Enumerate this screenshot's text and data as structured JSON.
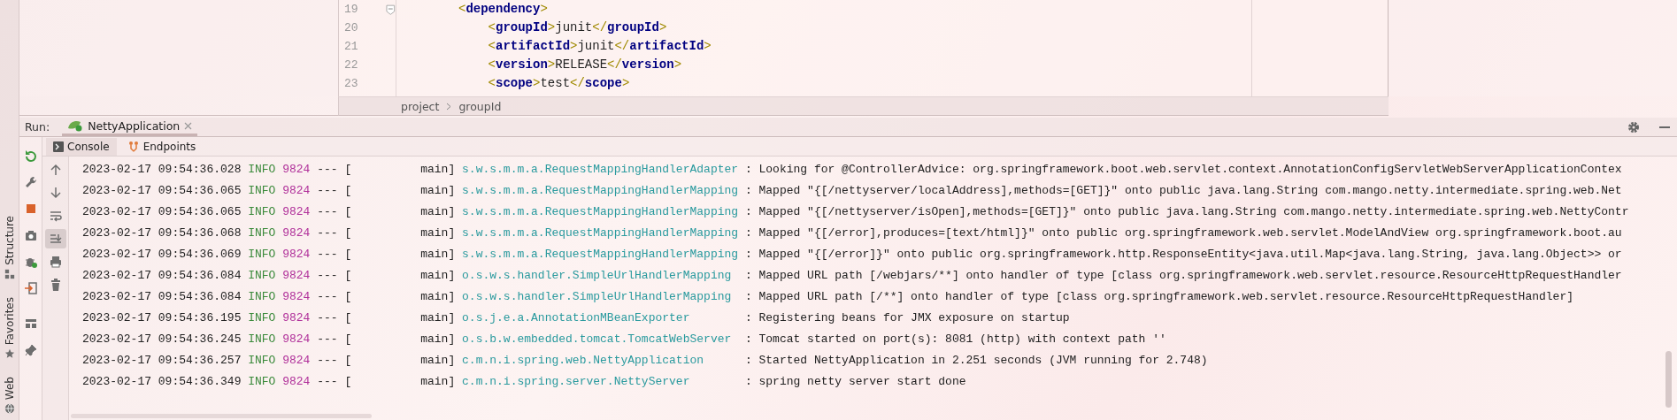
{
  "tool_stripe": {
    "labels": [
      {
        "kind": "structure",
        "text": "Structure"
      },
      {
        "kind": "favorites",
        "text": "Favorites"
      },
      {
        "kind": "web",
        "text": "Web"
      }
    ]
  },
  "editor": {
    "lines": [
      {
        "number": "19",
        "code": "<dependency>",
        "foldable": true
      },
      {
        "number": "20",
        "code": "    <groupId>junit</groupId>",
        "foldable": false
      },
      {
        "number": "21",
        "code": "    <artifactId>junit</artifactId>",
        "foldable": false
      },
      {
        "number": "22",
        "code": "    <version>RELEASE</version>",
        "foldable": false
      },
      {
        "number": "23",
        "code": "    <scope>test</scope>",
        "foldable": false
      }
    ]
  },
  "breadcrumbs": [
    "project",
    "groupId"
  ],
  "run_panel": {
    "label": "Run:",
    "tabs": [
      {
        "label": "NettyApplication",
        "selected": true
      }
    ],
    "subtabs": [
      {
        "kind": "console",
        "label": "Console",
        "selected": true
      },
      {
        "kind": "endpoints",
        "label": "Endpoints",
        "selected": false
      }
    ],
    "console_actions": [
      {
        "kind": "up",
        "on": false
      },
      {
        "kind": "down",
        "on": false
      },
      {
        "kind": "wrap",
        "on": false
      },
      {
        "kind": "scroll-end",
        "on": true
      },
      {
        "kind": "print",
        "on": false
      },
      {
        "kind": "trash",
        "on": false
      }
    ],
    "log": [
      {
        "time": "2023-02-17 09:54:36.028",
        "level": "INFO",
        "pid": "9824",
        "sep": "--- [",
        "thread": "main]",
        "logger": "s.w.s.m.m.a.RequestMappingHandlerAdapter",
        "message": ": Looking for @ControllerAdvice: org.springframework.boot.web.servlet.context.AnnotationConfigServletWebServerApplicationContex"
      },
      {
        "time": "2023-02-17 09:54:36.065",
        "level": "INFO",
        "pid": "9824",
        "sep": "--- [",
        "thread": "main]",
        "logger": "s.w.s.m.m.a.RequestMappingHandlerMapping",
        "message": ": Mapped \"{[/nettyserver/localAddress],methods=[GET]}\" onto public java.lang.String com.mango.netty.intermediate.spring.web.Net"
      },
      {
        "time": "2023-02-17 09:54:36.065",
        "level": "INFO",
        "pid": "9824",
        "sep": "--- [",
        "thread": "main]",
        "logger": "s.w.s.m.m.a.RequestMappingHandlerMapping",
        "message": ": Mapped \"{[/nettyserver/isOpen],methods=[GET]}\" onto public java.lang.String com.mango.netty.intermediate.spring.web.NettyContr"
      },
      {
        "time": "2023-02-17 09:54:36.068",
        "level": "INFO",
        "pid": "9824",
        "sep": "--- [",
        "thread": "main]",
        "logger": "s.w.s.m.m.a.RequestMappingHandlerMapping",
        "message": ": Mapped \"{[/error],produces=[text/html]}\" onto public org.springframework.web.servlet.ModelAndView org.springframework.boot.au"
      },
      {
        "time": "2023-02-17 09:54:36.069",
        "level": "INFO",
        "pid": "9824",
        "sep": "--- [",
        "thread": "main]",
        "logger": "s.w.s.m.m.a.RequestMappingHandlerMapping",
        "message": ": Mapped \"{[/error]}\" onto public org.springframework.http.ResponseEntity<java.util.Map<java.lang.String, java.lang.Object>> or"
      },
      {
        "time": "2023-02-17 09:54:36.084",
        "level": "INFO",
        "pid": "9824",
        "sep": "--- [",
        "thread": "main]",
        "logger": "o.s.w.s.handler.SimpleUrlHandlerMapping",
        "message": ": Mapped URL path [/webjars/**] onto handler of type [class org.springframework.web.servlet.resource.ResourceHttpRequestHandler"
      },
      {
        "time": "2023-02-17 09:54:36.084",
        "level": "INFO",
        "pid": "9824",
        "sep": "--- [",
        "thread": "main]",
        "logger": "o.s.w.s.handler.SimpleUrlHandlerMapping",
        "message": ": Mapped URL path [/**] onto handler of type [class org.springframework.web.servlet.resource.ResourceHttpRequestHandler]"
      },
      {
        "time": "2023-02-17 09:54:36.195",
        "level": "INFO",
        "pid": "9824",
        "sep": "--- [",
        "thread": "main]",
        "logger": "o.s.j.e.a.AnnotationMBeanExporter",
        "message": ": Registering beans for JMX exposure on startup"
      },
      {
        "time": "2023-02-17 09:54:36.245",
        "level": "INFO",
        "pid": "9824",
        "sep": "--- [",
        "thread": "main]",
        "logger": "o.s.b.w.embedded.tomcat.TomcatWebServer",
        "message": ": Tomcat started on port(s): 8081 (http) with context path ''"
      },
      {
        "time": "2023-02-17 09:54:36.257",
        "level": "INFO",
        "pid": "9824",
        "sep": "--- [",
        "thread": "main]",
        "logger": "c.m.n.i.spring.web.NettyApplication",
        "message": ": Started NettyApplication in 2.251 seconds (JVM running for 2.748)"
      },
      {
        "time": "2023-02-17 09:54:36.349",
        "level": "INFO",
        "pid": "9824",
        "sep": "--- [",
        "thread": "main]",
        "logger": "c.m.n.i.spring.server.NettyServer",
        "message": ": spring netty server start done"
      }
    ]
  }
}
